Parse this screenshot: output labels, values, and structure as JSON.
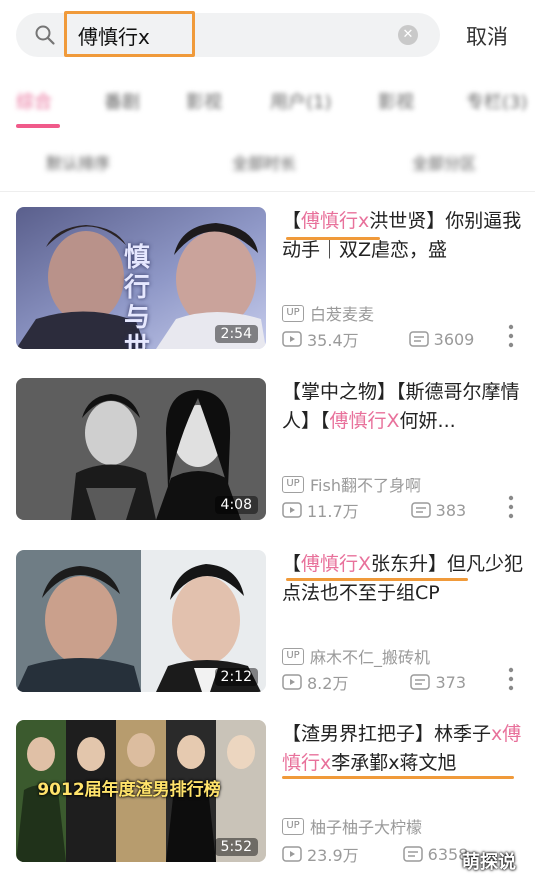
{
  "search": {
    "query": "傅慎行x",
    "cancel_label": "取消"
  },
  "tabs": [
    {
      "label": "综合",
      "active": true
    },
    {
      "label": "番剧",
      "active": false
    },
    {
      "label": "影视",
      "active": false
    },
    {
      "label": "用户(1)",
      "active": false
    },
    {
      "label": "影视",
      "active": false
    },
    {
      "label": "专栏(3)",
      "active": false
    }
  ],
  "filters": [
    {
      "label": "默认排序"
    },
    {
      "label": "全部时长"
    },
    {
      "label": "全部分区"
    }
  ],
  "videos": [
    {
      "title_pre": "【",
      "title_hl": "傅慎行x",
      "title_post": "洪世贤】你别逼我动手｜双Z虐恋，盛",
      "author": "白茇麦麦",
      "views": "35.4万",
      "danmaku": "3609",
      "duration": "2:54",
      "thumb_caption": "慎行与世"
    },
    {
      "title_pre": "【掌中之物】【斯德哥尔摩情人】【",
      "title_hl": "傅慎行X",
      "title_post": "何妍...",
      "author": "Fish翻不了身啊",
      "views": "11.7万",
      "danmaku": "383",
      "duration": "4:08",
      "thumb_caption": ""
    },
    {
      "title_pre": "【",
      "title_hl": "傅慎行X",
      "title_post": "张东升】但凡少犯点法也不至于组CP",
      "author": "麻木不仁_搬砖机",
      "views": "8.2万",
      "danmaku": "373",
      "duration": "2:12",
      "thumb_caption": ""
    },
    {
      "title_pre": "【渣男界扛把子】林季子",
      "title_hl": "x傅慎行x",
      "title_post": "李承鄞x蒋文旭",
      "author": "柚子柚子大柠檬",
      "views": "23.9万",
      "danmaku": "6358",
      "duration": "5:52",
      "thumb_caption": "9012届年度渣男排行榜"
    }
  ],
  "watermark": "萌探说",
  "colors": {
    "accent_pink": "#e8719b",
    "annotation_orange": "#f09a3a"
  }
}
